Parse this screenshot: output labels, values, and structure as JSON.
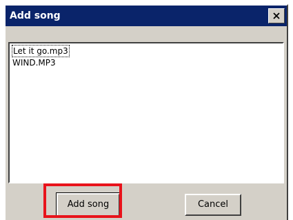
{
  "window": {
    "title": "Add song",
    "close_icon": "close-icon"
  },
  "song_list": {
    "items": [
      "Let it go.mp3",
      "WIND.MP3"
    ],
    "focused_item": "Let it go.mp3"
  },
  "buttons": {
    "add_label": "Add song",
    "cancel_label": "Cancel"
  },
  "colors": {
    "titlebar": "#0a246a",
    "face": "#d4d0c8",
    "highlight": "#e8131b"
  }
}
